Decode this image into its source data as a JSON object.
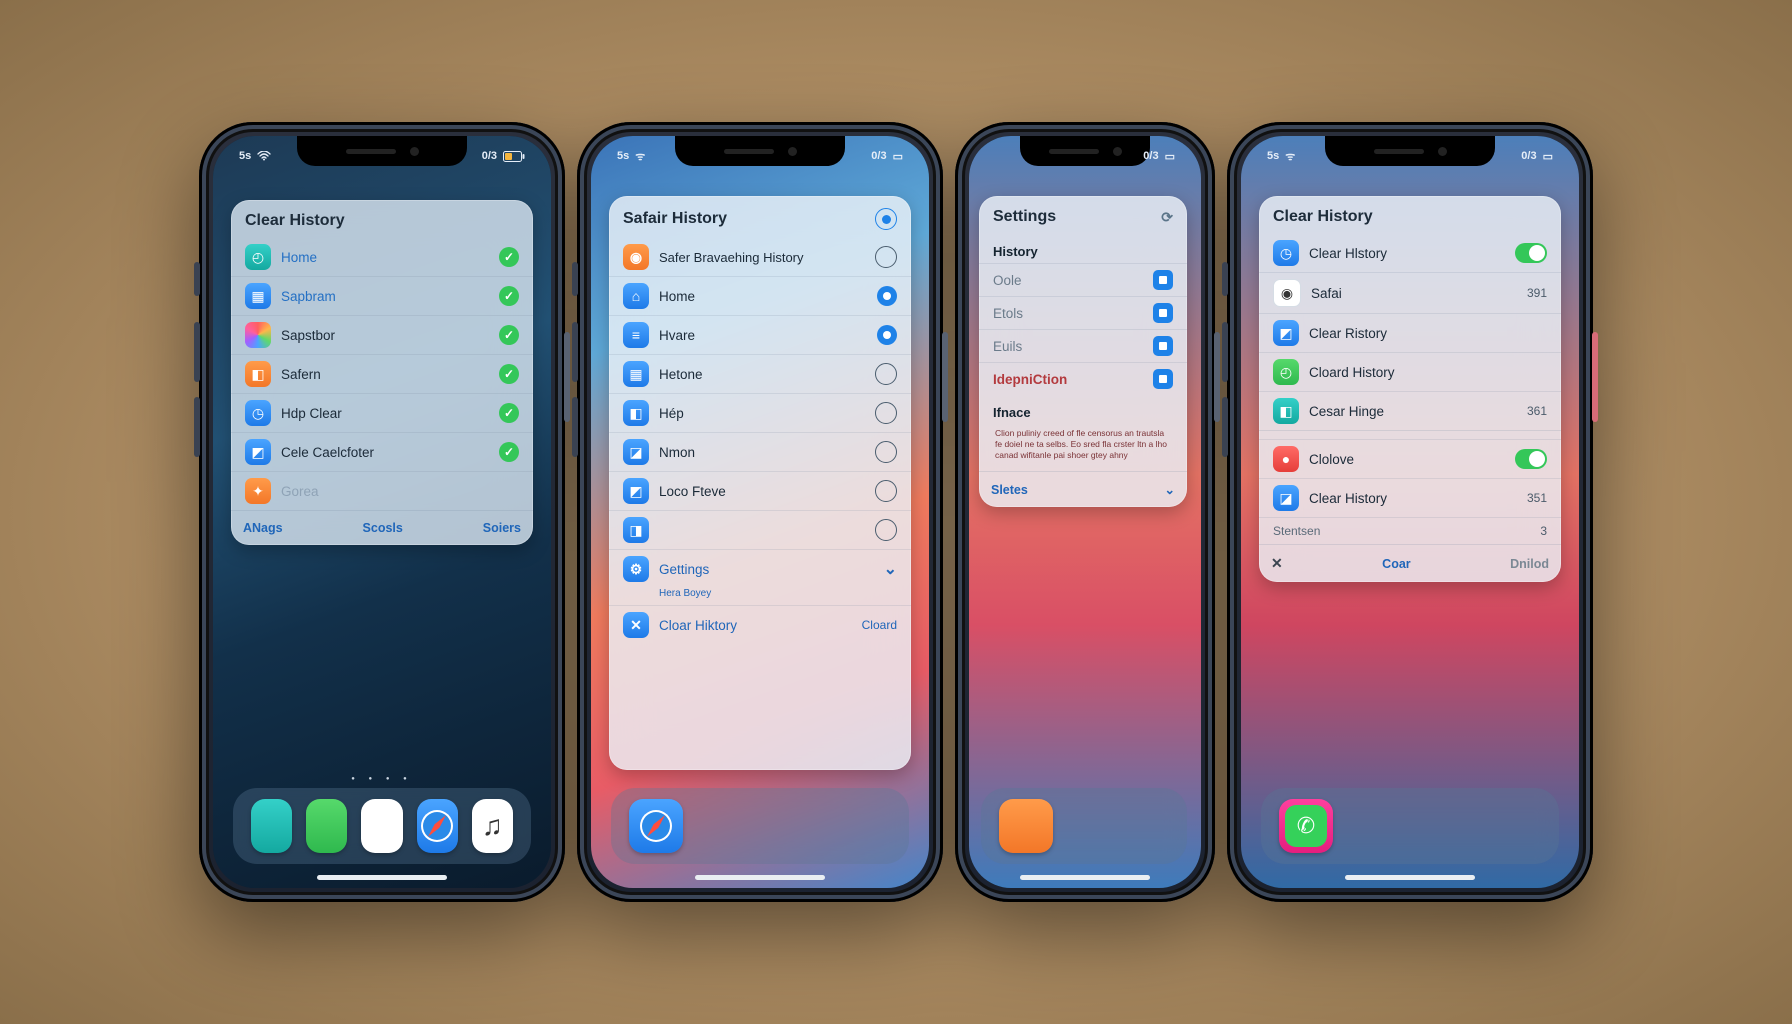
{
  "status": {
    "left": "5s",
    "right": "0/3"
  },
  "phone1": {
    "title": "Clear History",
    "items": [
      {
        "label": "Home",
        "icon": "bg-teal"
      },
      {
        "label": "Sapbram",
        "icon": "bg-blue"
      },
      {
        "label": "Sapstbor",
        "icon": "bg-rainbow"
      },
      {
        "label": "Safern",
        "icon": "bg-orange"
      },
      {
        "label": "Hdp Clear",
        "icon": "bg-blue"
      },
      {
        "label": "Cele Caelcfoter",
        "icon": "bg-blue"
      },
      {
        "label": "Gorea",
        "icon": "bg-orange"
      }
    ],
    "footer": {
      "a": "ANags",
      "b": "Scosls",
      "c": "Soiers"
    },
    "dock": [
      "bg-teal",
      "bg-green",
      "bg-white",
      "bg-blue",
      "bg-white"
    ]
  },
  "phone2": {
    "title": "Safair History",
    "sub": "Safer Bravaehing History",
    "items": [
      {
        "label": "Home",
        "trail": "radio-fill"
      },
      {
        "label": "Hvare",
        "trail": "radio-fill"
      },
      {
        "label": "Hetone",
        "trail": "outline"
      },
      {
        "label": "Hép",
        "trail": "outline"
      },
      {
        "label": "Nmon",
        "trail": "outline"
      },
      {
        "label": "Loco Fteve",
        "trail": "outline"
      },
      {
        "label": "",
        "trail": "outline"
      }
    ],
    "settings": "Gettings",
    "settingsSub": "Hera Boyey",
    "clear": {
      "label": "Cloar Hiktory",
      "trail": "Cloard"
    },
    "dock": [
      "bg-blue"
    ]
  },
  "phone3": {
    "title": "Settings",
    "section1": "History",
    "items1": [
      {
        "label": "Oole"
      },
      {
        "label": "Etols"
      },
      {
        "label": "Euils"
      },
      {
        "label": "IdepniCtion"
      }
    ],
    "section2": "Ifnace",
    "fine": "Clion puliniy creed of fle censorus an trautsla fe doiel ne ta selbs. Eo sred fla crster ltn a lho canad wifitanle pai shoer gtey ahny",
    "footerLabel": "Sletes",
    "dock": [
      "bg-orange"
    ]
  },
  "phone4": {
    "title": "Clear History",
    "items": [
      {
        "label": "Clear Hlstory",
        "trail": "toggle",
        "icon": "bg-blue"
      },
      {
        "label": "Safai",
        "trail": "391",
        "icon": "bg-white"
      },
      {
        "label": "Clear Ristory",
        "trail": "",
        "icon": "bg-blue"
      },
      {
        "label": "Cloard History",
        "trail": "",
        "icon": "bg-green"
      },
      {
        "label": "Cesar Hinge",
        "trail": "361",
        "icon": "bg-teal"
      }
    ],
    "items2": [
      {
        "label": "Clolove",
        "trail": "toggle",
        "icon": "bg-red"
      },
      {
        "label": "Clear History",
        "trail": "351",
        "icon": "bg-blue"
      }
    ],
    "footer1": "Stentsen",
    "footer": {
      "x": "✕",
      "a": "Coar",
      "b": "Dnilod"
    },
    "dock": [
      "bg-green"
    ]
  }
}
